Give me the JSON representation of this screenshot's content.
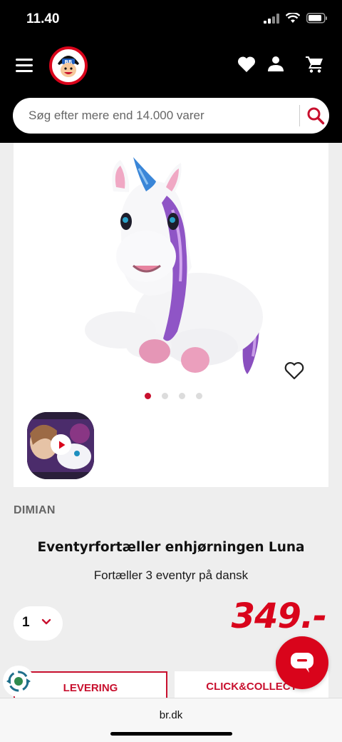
{
  "status": {
    "time": "11.40"
  },
  "header": {
    "search_placeholder": "Søg efter mere end 14.000 varer"
  },
  "icons": {
    "menu": "menu-icon",
    "logo": "br-logo",
    "wishlist": "heart-icon",
    "account": "person-icon",
    "cart": "cart-icon",
    "search": "search-icon",
    "favorite": "heart-outline-icon",
    "play": "play-icon",
    "chevron": "chevron-down-icon",
    "chat": "chat-icon",
    "eco": "eco-icon"
  },
  "gallery": {
    "dot_count": 4,
    "active_dot": 0
  },
  "product": {
    "brand": "DIMIAN",
    "title": "Eventyrfortæller enhjørningen Luna",
    "subtitle": "Fortæller 3 eventyr på dansk",
    "quantity": "1",
    "price": "349.-"
  },
  "delivery": {
    "levering_label": "LEVERING",
    "click_collect_label": "CLICK&COLLECT"
  },
  "browser": {
    "url": "br.dk"
  },
  "colors": {
    "accent": "#d9041b",
    "header_bg": "#000000",
    "page_bg": "#eeeeee"
  }
}
